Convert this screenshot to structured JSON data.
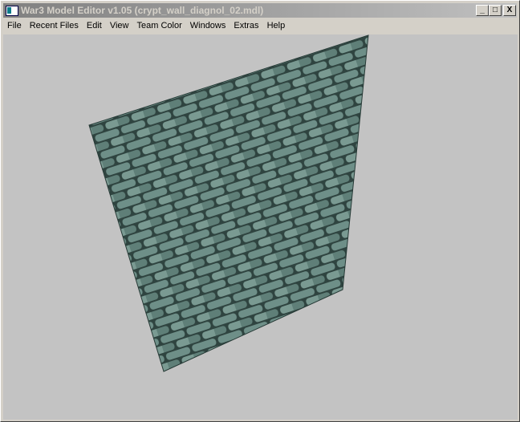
{
  "window": {
    "title": "War3 Model Editor v1.05 (crypt_wall_diagnol_02.mdl)",
    "minimize": "_",
    "maximize": "□",
    "close": "X"
  },
  "menu": [
    "File",
    "Recent Files",
    "Edit",
    "View",
    "Team Color",
    "Windows",
    "Extras",
    "Help"
  ],
  "colors": {
    "viewport": "#c3c3c3",
    "stone": "#5f7f78"
  }
}
